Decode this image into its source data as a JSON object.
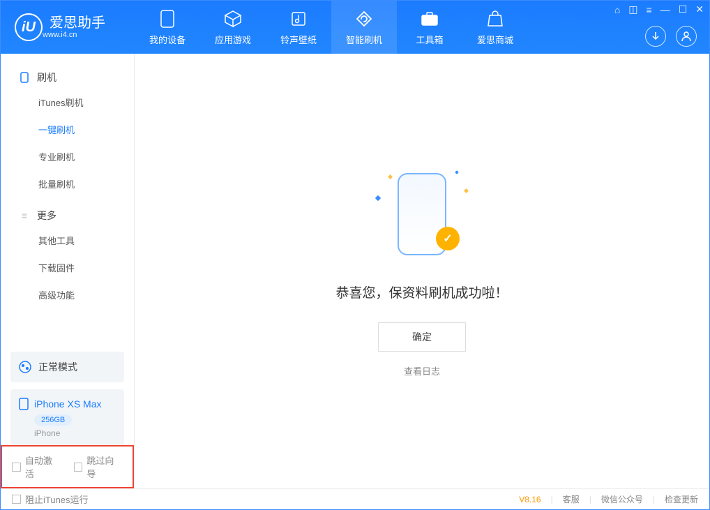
{
  "app": {
    "name": "爱思助手",
    "site": "www.i4.cn"
  },
  "tabs": [
    {
      "label": "我的设备"
    },
    {
      "label": "应用游戏"
    },
    {
      "label": "铃声壁纸"
    },
    {
      "label": "智能刷机"
    },
    {
      "label": "工具箱"
    },
    {
      "label": "爱思商城"
    }
  ],
  "sidebar": {
    "section1": {
      "title": "刷机",
      "items": [
        {
          "label": "iTunes刷机"
        },
        {
          "label": "一键刷机"
        },
        {
          "label": "专业刷机"
        },
        {
          "label": "批量刷机"
        }
      ]
    },
    "section2": {
      "title": "更多",
      "items": [
        {
          "label": "其他工具"
        },
        {
          "label": "下载固件"
        },
        {
          "label": "高级功能"
        }
      ]
    }
  },
  "device": {
    "mode": "正常模式",
    "name": "iPhone XS Max",
    "storage": "256GB",
    "type": "iPhone"
  },
  "bottom": {
    "auto_activate": "自动激活",
    "skip_guide": "跳过向导"
  },
  "main": {
    "success_msg": "恭喜您，保资料刷机成功啦！",
    "ok": "确定",
    "log": "查看日志"
  },
  "footer": {
    "block_itunes": "阻止iTunes运行",
    "version": "V8.16",
    "support": "客服",
    "wechat": "微信公众号",
    "update": "检查更新"
  }
}
